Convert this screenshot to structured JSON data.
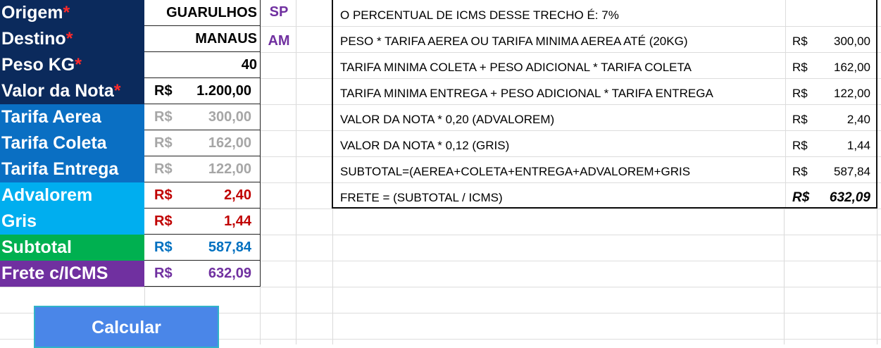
{
  "form": {
    "rows": [
      {
        "label": "Origem",
        "required": "*",
        "value": "GUARULHOS",
        "uf": "SP",
        "bg": "#0b2a5c"
      },
      {
        "label": "Destino",
        "required": "*",
        "value": "MANAUS",
        "uf": "AM",
        "bg": "#0b2a5c"
      },
      {
        "label": "Peso KG",
        "required": "*",
        "value": "40",
        "bg": "#0b2a5c"
      },
      {
        "label": "Valor da Nota",
        "required": "*",
        "currency": "R$",
        "value": "1.200,00",
        "bg": "#0b2a5c",
        "color": "#000000"
      },
      {
        "label": "Tarifa Aerea",
        "currency": "R$",
        "value": "300,00",
        "bg": "#0a6fc3",
        "color": "#a6a6a6"
      },
      {
        "label": "Tarifa Coleta",
        "currency": "R$",
        "value": "162,00",
        "bg": "#0a6fc3",
        "color": "#a6a6a6"
      },
      {
        "label": "Tarifa Entrega",
        "currency": "R$",
        "value": "122,00",
        "bg": "#0a6fc3",
        "color": "#a6a6a6"
      },
      {
        "label": "Advalorem",
        "currency": "R$",
        "value": "2,40",
        "bg": "#00aeef",
        "color": "#c00000"
      },
      {
        "label": "Gris",
        "currency": "R$",
        "value": "1,44",
        "bg": "#00aeef",
        "color": "#c00000"
      },
      {
        "label": "Subtotal",
        "currency": "R$",
        "value": "587,84",
        "bg": "#00b050",
        "color": "#0070c0"
      },
      {
        "label": "Frete c/ICMS",
        "currency": "R$",
        "value": "632,09",
        "bg": "#7030a0",
        "color": "#7030a0"
      }
    ],
    "button_label": "Calcular"
  },
  "formulas": {
    "header": "O PERCENTUAL DE ICMS DESSE TRECHO É:  7%",
    "rows": [
      {
        "desc": "PESO * TARIFA AEREA OU TARIFA MINIMA AEREA ATÉ  (20KG)",
        "currency": "R$",
        "value": "300,00"
      },
      {
        "desc": "TARIFA MINIMA COLETA + PESO ADICIONAL * TARIFA COLETA",
        "currency": "R$",
        "value": "162,00"
      },
      {
        "desc": "TARIFA MINIMA ENTREGA + PESO ADICIONAL * TARIFA ENTREGA",
        "currency": "R$",
        "value": "122,00"
      },
      {
        "desc": "VALOR DA NOTA * 0,20 (ADVALOREM)",
        "currency": "R$",
        "value": "2,40"
      },
      {
        "desc": "VALOR DA NOTA * 0,12 (GRIS)",
        "currency": "R$",
        "value": "1,44"
      },
      {
        "desc": "SUBTOTAL=(AEREA+COLETA+ENTREGA+ADVALOREM+GRIS",
        "currency": "R$",
        "value": "587,84"
      },
      {
        "desc": "FRETE = (SUBTOTAL / ICMS)",
        "currency": "R$",
        "value": "632,09",
        "total": true
      }
    ]
  },
  "colors": {
    "accent_uf": "#7030a0",
    "required_mark": "#ff2a2a",
    "button": "#4a86e8"
  }
}
